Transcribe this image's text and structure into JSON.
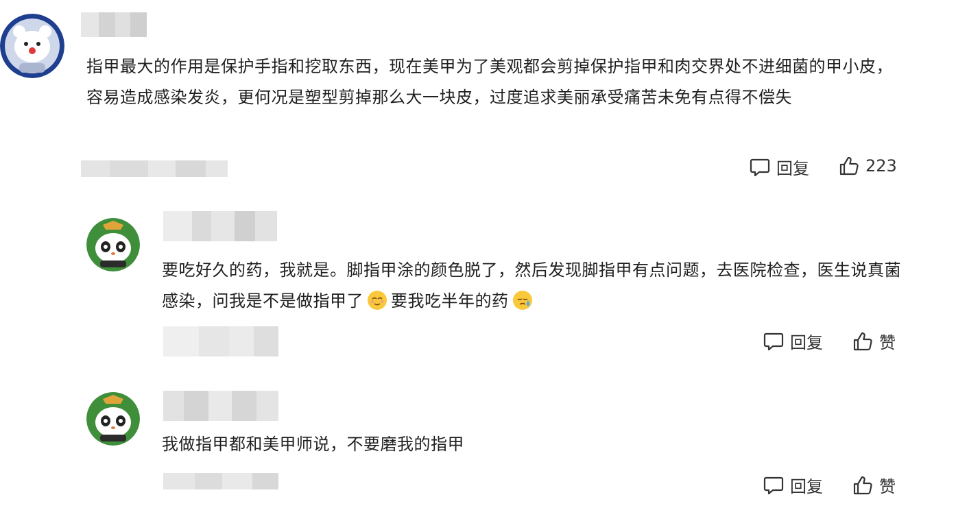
{
  "comments": [
    {
      "text": "指甲最大的作用是保护手指和挖取东西，现在美甲为了美观都会剪掉保护指甲和肉交界处不进细菌的甲小皮，容易造成感染发炎，更何况是塑型剪掉那么大一块皮，过度追求美丽承受痛苦未免有点得不偿失",
      "reply_label": "回复",
      "like_label": "223",
      "avatar_icon": "polar-bear-avatar-icon"
    }
  ],
  "replies": [
    {
      "text_part1": "要吃好久的药，我就是。脚指甲涂的颜色脱了，然后发现脚指甲有点问题，去医院检查，医生说真菌感染，问我是不是做指甲了",
      "text_part2": "要我吃半年的药",
      "emoji1": "relieved-face-emoji",
      "emoji2": "crying-face-emoji",
      "reply_label": "回复",
      "like_label": "赞",
      "avatar_icon": "panda-avatar-icon"
    },
    {
      "text": "我做指甲都和美甲师说，不要磨我的指甲",
      "reply_label": "回复",
      "like_label": "赞",
      "avatar_icon": "panda-avatar-icon"
    }
  ],
  "colors": {
    "accent_blue": "#1e3f8f",
    "panda_green": "#3f8f3a",
    "blur_gray": "#d9d9d9"
  }
}
